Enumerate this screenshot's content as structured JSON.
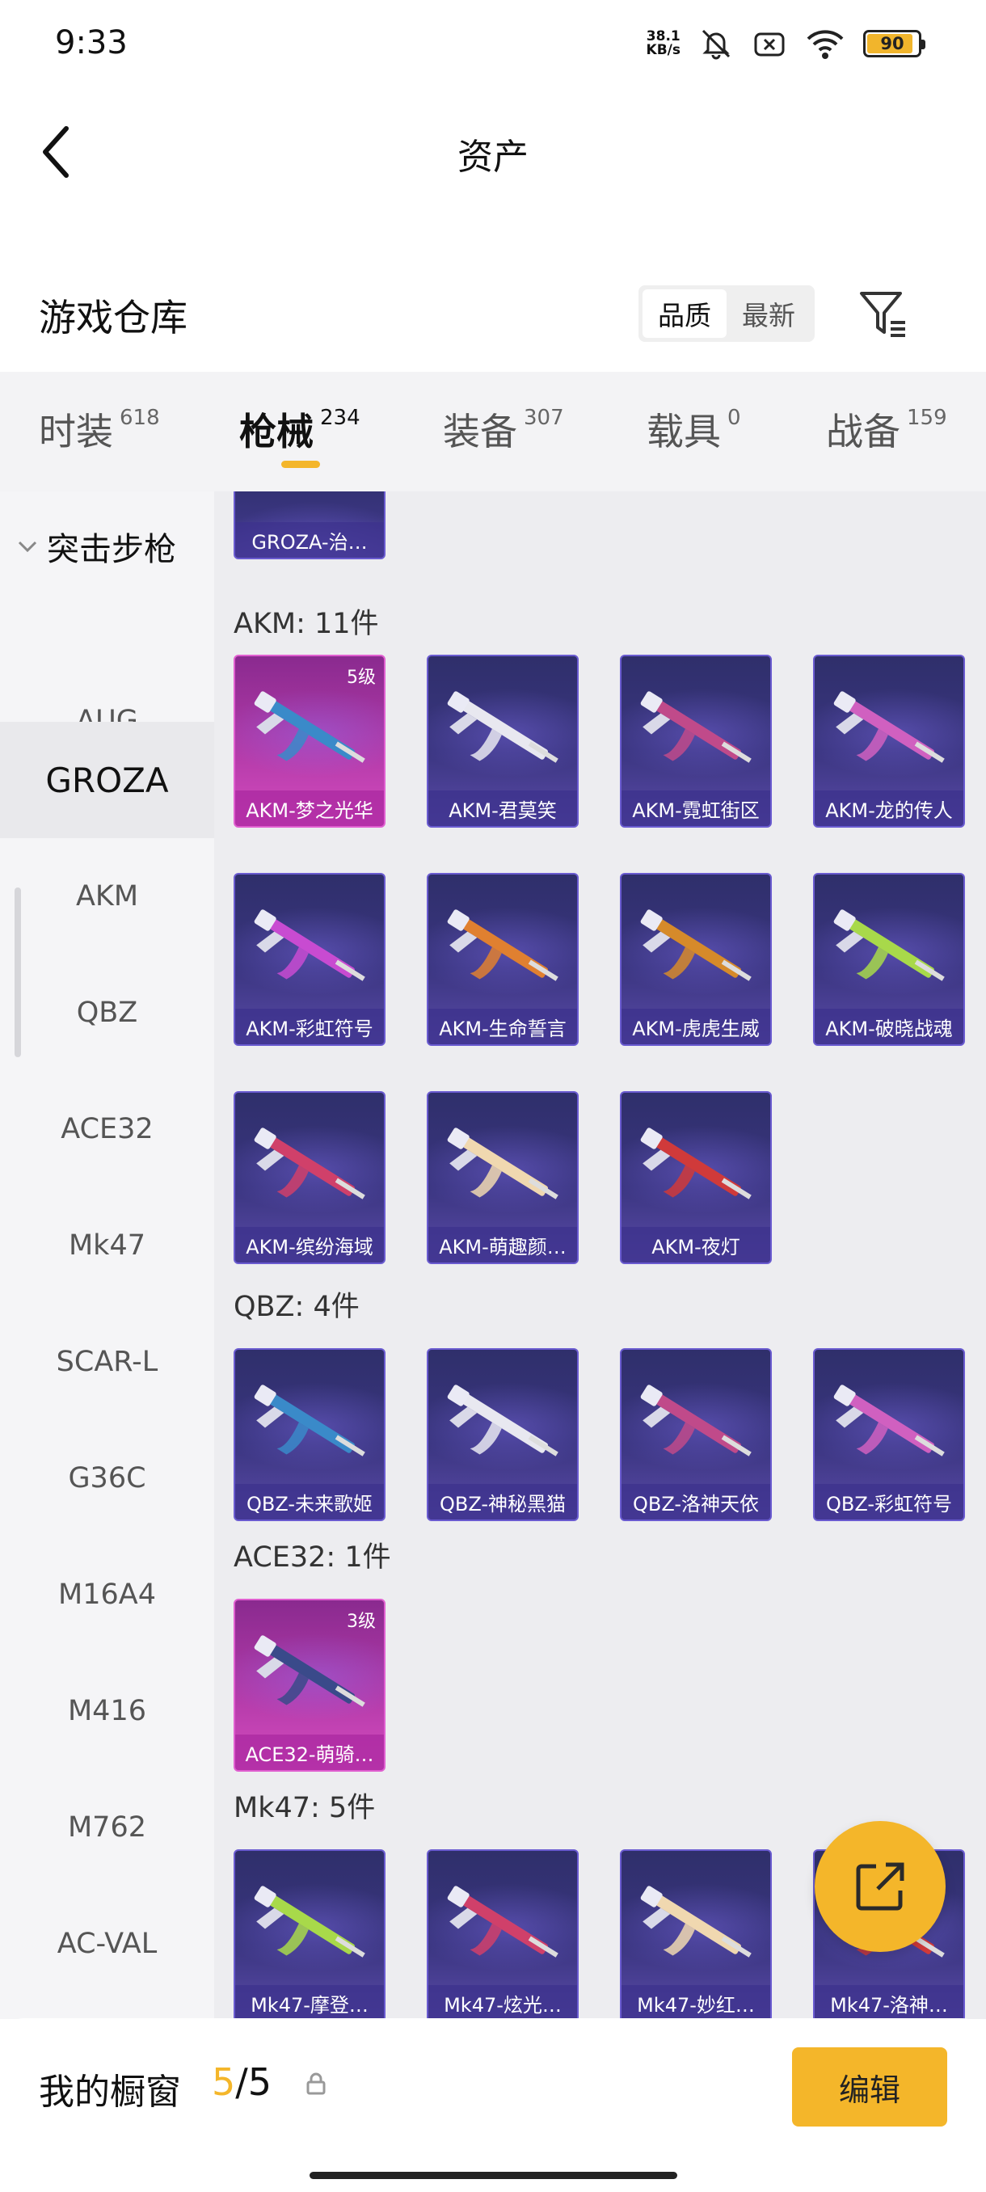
{
  "status": {
    "time": "9:33",
    "net_speed_top": "38.1",
    "net_speed_bottom": "KB/s",
    "battery": "90",
    "battery_level": 0.9
  },
  "header": {
    "title": "资产"
  },
  "warehouse": {
    "title": "游戏仓库",
    "sort_options": [
      "品质",
      "最新"
    ],
    "sort_active": "品质"
  },
  "tabs": [
    {
      "label": "时装",
      "count": "618"
    },
    {
      "label": "枪械",
      "count": "234"
    },
    {
      "label": "装备",
      "count": "307"
    },
    {
      "label": "载具",
      "count": "0"
    },
    {
      "label": "战备",
      "count": "159"
    }
  ],
  "sidebar": {
    "group": "突击步枪",
    "items": [
      "AUG",
      "GROZA",
      "AKM",
      "QBZ",
      "ACE32",
      "Mk47",
      "SCAR-L",
      "G36C",
      "M16A4",
      "M416",
      "M762",
      "AC-VAL"
    ],
    "active": "GROZA"
  },
  "sections": {
    "groza_card": {
      "name": "GROZA-治…"
    },
    "akm": {
      "title": "AKM: 11件",
      "items": [
        {
          "name": "AKM-梦之光华",
          "level": "5级",
          "rarity": "pink"
        },
        {
          "name": "AKM-君莫笑"
        },
        {
          "name": "AKM-霓虹街区"
        },
        {
          "name": "AKM-龙的传人"
        },
        {
          "name": "AKM-彩虹符号"
        },
        {
          "name": "AKM-生命誓言"
        },
        {
          "name": "AKM-虎虎生威"
        },
        {
          "name": "AKM-破晓战魂"
        },
        {
          "name": "AKM-缤纷海域"
        },
        {
          "name": "AKM-萌趣颜…"
        },
        {
          "name": "AKM-夜灯"
        }
      ]
    },
    "qbz": {
      "title": "QBZ: 4件",
      "items": [
        {
          "name": "QBZ-未来歌姬"
        },
        {
          "name": "QBZ-神秘黑猫"
        },
        {
          "name": "QBZ-洛神天依"
        },
        {
          "name": "QBZ-彩虹符号"
        }
      ]
    },
    "ace32": {
      "title": "ACE32: 1件",
      "items": [
        {
          "name": "ACE32-萌骑…",
          "level": "3级",
          "rarity": "pink"
        }
      ]
    },
    "mk47": {
      "title": "Mk47: 5件",
      "items": [
        {
          "name": "Mk47-摩登…"
        },
        {
          "name": "Mk47-炫光…"
        },
        {
          "name": "Mk47-妙红…"
        },
        {
          "name": "Mk47-洛神…"
        }
      ]
    }
  },
  "showcase": {
    "label": "我的橱窗",
    "current": "5",
    "total": "/5",
    "edit_label": "编辑"
  },
  "colors": {
    "accent": "#f4b62a",
    "card_purple": "#3a3580",
    "card_pink": "#b23aa8"
  }
}
